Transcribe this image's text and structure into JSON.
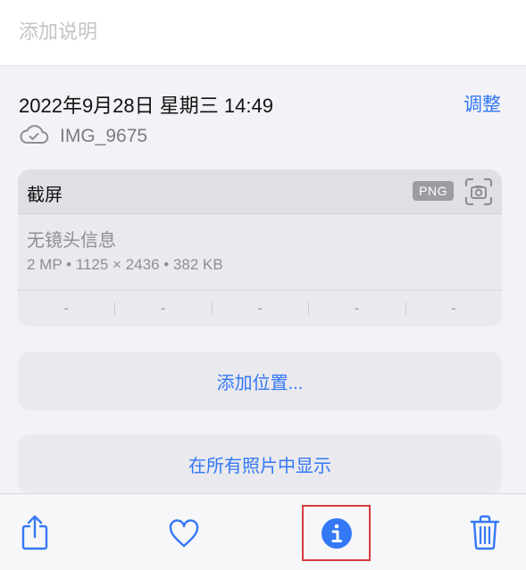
{
  "caption": {
    "placeholder": "添加说明"
  },
  "meta": {
    "datetime": "2022年9月28日 星期三 14:49",
    "adjust_label": "调整",
    "filename": "IMG_9675",
    "cloud_icon": "cloud-check-icon"
  },
  "info_card": {
    "title": "截屏",
    "badge": "PNG",
    "camera_icon": "screenshot-camera-icon",
    "lens": "无镜头信息",
    "specs": "2 MP  •  1125 × 2436  •  382 KB",
    "exif": [
      "-",
      "-",
      "-",
      "-",
      "-"
    ]
  },
  "actions": {
    "add_location": "添加位置...",
    "show_in_all_photos": "在所有照片中显示"
  },
  "toolbar": {
    "icons": [
      "share-icon",
      "heart-icon",
      "info-icon",
      "trash-icon"
    ],
    "accent": "#3478f6"
  },
  "colors": {
    "accent": "#3478f6",
    "highlight": "#d63b3b"
  }
}
